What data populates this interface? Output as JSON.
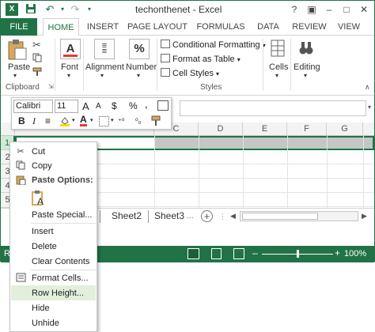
{
  "window": {
    "title": "techonthenet - Excel"
  },
  "qat": {
    "icons": [
      "excel-logo-icon",
      "save-icon",
      "undo-icon",
      "redo-icon"
    ]
  },
  "winctl": {
    "help": "?",
    "ribbon_display": "▣",
    "minimize": "–",
    "restore": "□",
    "close": "✕"
  },
  "tabs": [
    "FILE",
    "HOME",
    "INSERT",
    "PAGE LAYOUT",
    "FORMULAS",
    "DATA",
    "REVIEW",
    "VIEW"
  ],
  "ribbon": {
    "paste": "Paste",
    "clipboard": "Clipboard",
    "font": "Font",
    "alignment": "Alignment",
    "number": "Number",
    "number_glyph": "%",
    "font_glyph": "A",
    "cond_format": "Conditional Formatting",
    "format_table": "Format as Table",
    "cell_styles": "Cell Styles",
    "styles": "Styles",
    "cells": "Cells",
    "editing": "Editing"
  },
  "mini_toolbar": {
    "font_name": "Calibri",
    "font_size": "11",
    "row1_glyphs": [
      "A",
      "A",
      "$",
      "%",
      ","
    ],
    "row2_glyphs": [
      "B",
      "I",
      "≡",
      "A"
    ]
  },
  "columns": [
    "C",
    "D",
    "E",
    "F",
    "G"
  ],
  "rows": [
    "1",
    "2",
    "3",
    "4",
    "5",
    "6",
    "7"
  ],
  "sheets": {
    "tab1": "Sheet2",
    "tab2": "Sheet3"
  },
  "status": {
    "mode": "R",
    "zoom": "100%",
    "zoom_level_percent": 100
  },
  "context_menu": {
    "cut": "Cut",
    "copy": "Copy",
    "paste_options": "Paste Options:",
    "paste_special": "Paste Special...",
    "insert": "Insert",
    "delete": "Delete",
    "clear_contents": "Clear Contents",
    "format_cells": "Format Cells...",
    "row_height": "Row Height...",
    "hide": "Hide",
    "unhide": "Unhide"
  },
  "colors": {
    "accent": "#217346",
    "hover": "#e2efda"
  }
}
